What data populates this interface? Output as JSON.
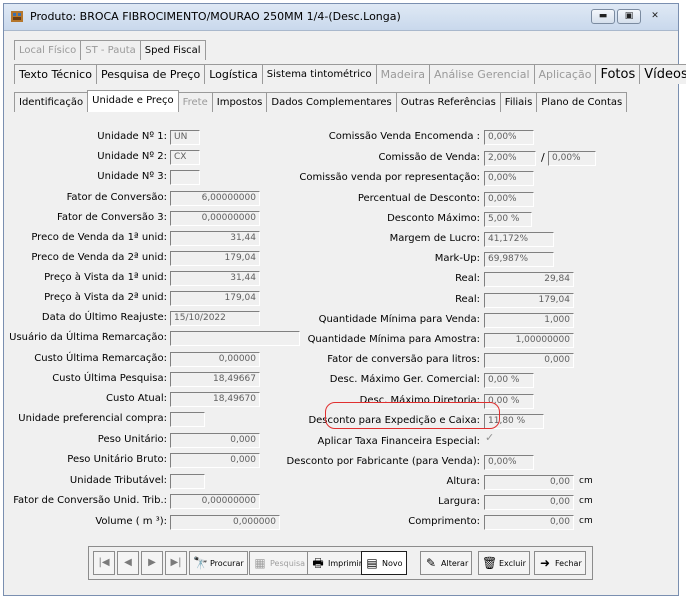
{
  "window": {
    "title": "Produto: BROCA FIBROCIMENTO/MOURAO 250MM 1/4-(Desc.Longa)"
  },
  "tabs_row1": [
    {
      "label": "Local Físico",
      "enabled": false
    },
    {
      "label": "ST - Pauta",
      "enabled": false
    },
    {
      "label": "Sped Fiscal",
      "enabled": true
    }
  ],
  "tabs_row2": [
    {
      "label": "Texto Técnico",
      "enabled": true
    },
    {
      "label": "Pesquisa de Preço",
      "enabled": true
    },
    {
      "label": "Logística",
      "enabled": true
    },
    {
      "label": "Sistema tintométrico",
      "enabled": true
    },
    {
      "label": "Madeira",
      "enabled": false
    },
    {
      "label": "Análise Gerencial",
      "enabled": false
    },
    {
      "label": "Aplicação",
      "enabled": false
    },
    {
      "label": "Fotos",
      "enabled": true
    },
    {
      "label": "Vídeos",
      "enabled": true
    }
  ],
  "tabs_row3": [
    {
      "label": "Identificação",
      "enabled": true
    },
    {
      "label": "Unidade e Preço",
      "enabled": true,
      "selected": true
    },
    {
      "label": "Frete",
      "enabled": false
    },
    {
      "label": "Impostos",
      "enabled": true
    },
    {
      "label": "Dados Complementares",
      "enabled": true
    },
    {
      "label": "Outras Referências",
      "enabled": true
    },
    {
      "label": "Filiais",
      "enabled": true
    },
    {
      "label": "Plano de Contas",
      "enabled": true
    }
  ],
  "left_fields": [
    {
      "label": "Unidade Nº 1:",
      "value": "UN"
    },
    {
      "label": "Unidade Nº 2:",
      "value": "CX"
    },
    {
      "label": "Unidade Nº 3:",
      "value": ""
    },
    {
      "label": "Fator de Conversão:",
      "value": "6,00000000"
    },
    {
      "label": "Fator de Conversão 3:",
      "value": "0,00000000"
    },
    {
      "label": "Preco de Venda da 1ª unid:",
      "value": "31,44"
    },
    {
      "label": "Preco de Venda da 2ª unid:",
      "value": "179,04"
    },
    {
      "label": "Preço à Vista da 1ª unid:",
      "value": "31,44"
    },
    {
      "label": "Preço à Vista da 2ª unid:",
      "value": "179,04"
    },
    {
      "label": "Data do Último Reajuste:",
      "value": "15/10/2022"
    },
    {
      "label": "Usuário da Última Remarcação:",
      "value": ""
    },
    {
      "label": "Custo Última Remarcação:",
      "value": "0,00000"
    },
    {
      "label": "Custo Última Pesquisa:",
      "value": "18,49667"
    },
    {
      "label": "Custo Atual:",
      "value": "18,49670"
    },
    {
      "label": "Unidade preferencial compra:",
      "value": ""
    },
    {
      "label": "Peso Unitário:",
      "value": "0,000"
    },
    {
      "label": "Peso Unitário Bruto:",
      "value": "0,000"
    },
    {
      "label": "Unidade Tributável:",
      "value": ""
    },
    {
      "label": "Fator de Conversão Unid. Trib.:",
      "value": "0,00000000"
    },
    {
      "label": "Volume ( m ³):",
      "value": "0,000000"
    }
  ],
  "right_fields": [
    {
      "label": "Comissão Venda Encomenda :",
      "value": "0,00%"
    },
    {
      "label": "Comissão de Venda:",
      "value": "2,00%",
      "value2": "0,00%"
    },
    {
      "label": "Comissão venda por representação:",
      "value": "0,00%"
    },
    {
      "label": "Percentual de Desconto:",
      "value": "0,00%"
    },
    {
      "label": "Desconto Máximo:",
      "value": "5,00 %"
    },
    {
      "label": "Margem de Lucro:",
      "value": "41,172%"
    },
    {
      "label": "Mark-Up:",
      "value": "69,987%"
    },
    {
      "label": "Real:",
      "value": "29,84"
    },
    {
      "label": "Real:",
      "value": "179,04"
    },
    {
      "label": "Quantidade Mínima para Venda:",
      "value": "1,000"
    },
    {
      "label": "Quantidade Mínima para Amostra:",
      "value": "1,00000000"
    },
    {
      "label": "Fator de conversão para litros:",
      "value": "0,000"
    },
    {
      "label": "Desc. Máximo Ger. Comercial:",
      "value": "0,00 %"
    },
    {
      "label": "Desc. Máximo Diretoria:",
      "value": "0,00 %"
    },
    {
      "label": "Desconto para Expedição e Caixa:",
      "value": "11,80 %"
    },
    {
      "label": "Aplicar Taxa Financeira Especial:",
      "value": "✓"
    },
    {
      "label": "Desconto por Fabricante (para Venda):",
      "value": "0,00%"
    },
    {
      "label": "Altura:",
      "value": "0,00",
      "unit": "cm"
    },
    {
      "label": "Largura:",
      "value": "0,00",
      "unit": "cm"
    },
    {
      "label": "Comprimento:",
      "value": "0,00",
      "unit": "cm"
    }
  ],
  "nav": {
    "procurar": "Procurar",
    "pesquisa": "Pesquisa",
    "imprimir": "Imprimir",
    "novo": "Novo",
    "alterar": "Alterar",
    "excluir": "Excluir",
    "fechar": "Fechar"
  }
}
